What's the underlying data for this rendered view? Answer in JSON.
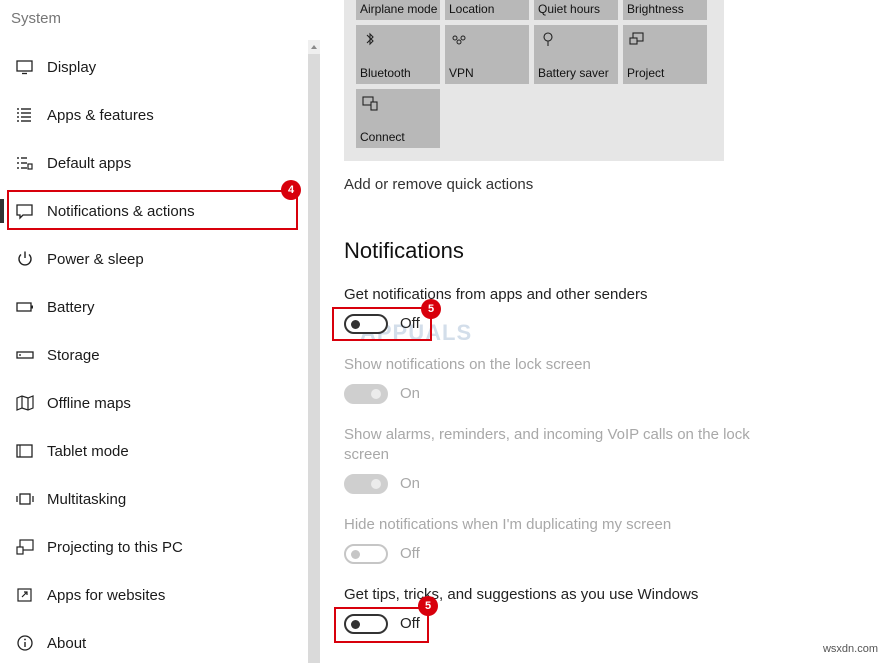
{
  "sidebar": {
    "title": "System",
    "items": [
      {
        "label": "Display",
        "icon": "monitor-icon"
      },
      {
        "label": "Apps & features",
        "icon": "list-icon"
      },
      {
        "label": "Default apps",
        "icon": "default-apps-icon"
      },
      {
        "label": "Notifications & actions",
        "icon": "speech-bubble-icon"
      },
      {
        "label": "Power & sleep",
        "icon": "power-icon"
      },
      {
        "label": "Battery",
        "icon": "battery-icon"
      },
      {
        "label": "Storage",
        "icon": "storage-icon"
      },
      {
        "label": "Offline maps",
        "icon": "map-icon"
      },
      {
        "label": "Tablet mode",
        "icon": "tablet-icon"
      },
      {
        "label": "Multitasking",
        "icon": "multitasking-icon"
      },
      {
        "label": "Projecting to this PC",
        "icon": "projecting-icon"
      },
      {
        "label": "Apps for websites",
        "icon": "apps-websites-icon"
      },
      {
        "label": "About",
        "icon": "info-icon"
      }
    ],
    "selected": "Notifications & actions"
  },
  "quick_actions": {
    "tiles": [
      {
        "label": "Airplane mode"
      },
      {
        "label": "Location"
      },
      {
        "label": "Quiet hours"
      },
      {
        "label": "Brightness"
      },
      {
        "label": "Bluetooth",
        "icon": "bluetooth-icon"
      },
      {
        "label": "VPN",
        "icon": "vpn-icon"
      },
      {
        "label": "Battery saver",
        "icon": "battery-saver-icon"
      },
      {
        "label": "Project",
        "icon": "project-icon"
      },
      {
        "label": "Connect",
        "icon": "connect-icon"
      }
    ],
    "add_remove_link": "Add or remove quick actions"
  },
  "notifications": {
    "heading": "Notifications",
    "settings": [
      {
        "label": "Get notifications from apps and other senders",
        "state": "Off"
      },
      {
        "label": "Show notifications on the lock screen",
        "state": "On"
      },
      {
        "label": "Show alarms, reminders, and incoming VoIP calls on the lock screen",
        "state": "On"
      },
      {
        "label": "Hide notifications when I'm duplicating my screen",
        "state": "Off"
      },
      {
        "label": "Get tips, tricks, and suggestions as you use Windows",
        "state": "Off"
      }
    ]
  },
  "annotations": {
    "step_4": "4",
    "step_5": "5",
    "highlight_color": "#d8000c"
  },
  "watermark": "APPUALS",
  "footer": "wsxdn.com"
}
